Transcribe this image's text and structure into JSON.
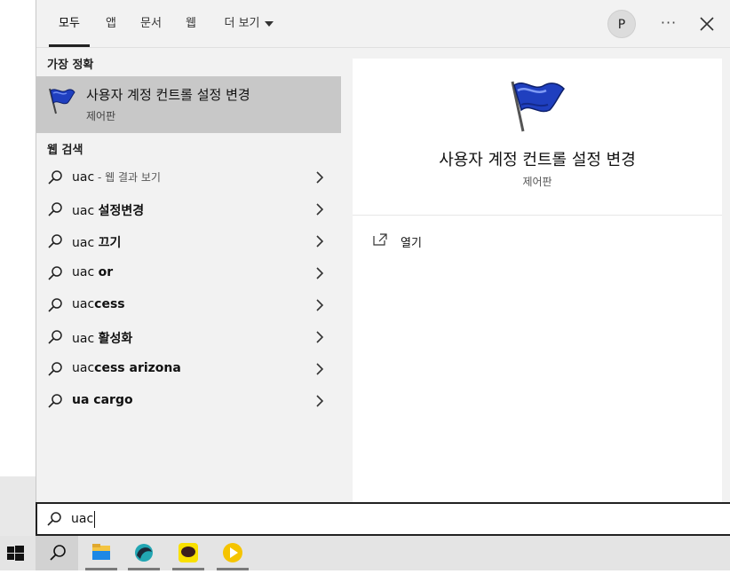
{
  "tabs": [
    {
      "label": "모두",
      "active": true
    },
    {
      "label": "앱"
    },
    {
      "label": "문서"
    },
    {
      "label": "웹"
    },
    {
      "label": "더 보기"
    }
  ],
  "avatar_initial": "P",
  "more_label": "···",
  "best_match": {
    "section_label": "가장 정확",
    "title": "사용자 계정 컨트롤 설정 변경",
    "subtitle": "제어판"
  },
  "web_search": {
    "section_label": "웹 검색",
    "items": [
      {
        "prefix": "uac",
        "bold": "",
        "muted": " - 웹 결과 보기"
      },
      {
        "prefix": "uac ",
        "bold": "설정변경",
        "muted": ""
      },
      {
        "prefix": "uac ",
        "bold": "끄기",
        "muted": ""
      },
      {
        "prefix": "uac ",
        "bold": "or",
        "muted": ""
      },
      {
        "prefix": "uac",
        "bold": "cess",
        "muted": ""
      },
      {
        "prefix": "uac ",
        "bold": "활성화",
        "muted": ""
      },
      {
        "prefix": "uac",
        "bold": "cess arizona",
        "muted": ""
      },
      {
        "prefix": "",
        "bold": "ua cargo",
        "muted": ""
      }
    ]
  },
  "detail": {
    "title": "사용자 계정 컨트롤 설정 변경",
    "subtitle": "제어판",
    "open_label": "열기"
  },
  "search": {
    "value": "uac"
  },
  "taskbar": {
    "apps": [
      "file-explorer-icon",
      "edge-app-icon",
      "kakaotalk-icon",
      "media-player-icon"
    ]
  },
  "colors": {
    "panel_bg": "#f2f2f2",
    "selected_bg": "#c8c8c8",
    "flag_blue": "#1f3fbf",
    "kakao_yellow": "#f9e000"
  }
}
